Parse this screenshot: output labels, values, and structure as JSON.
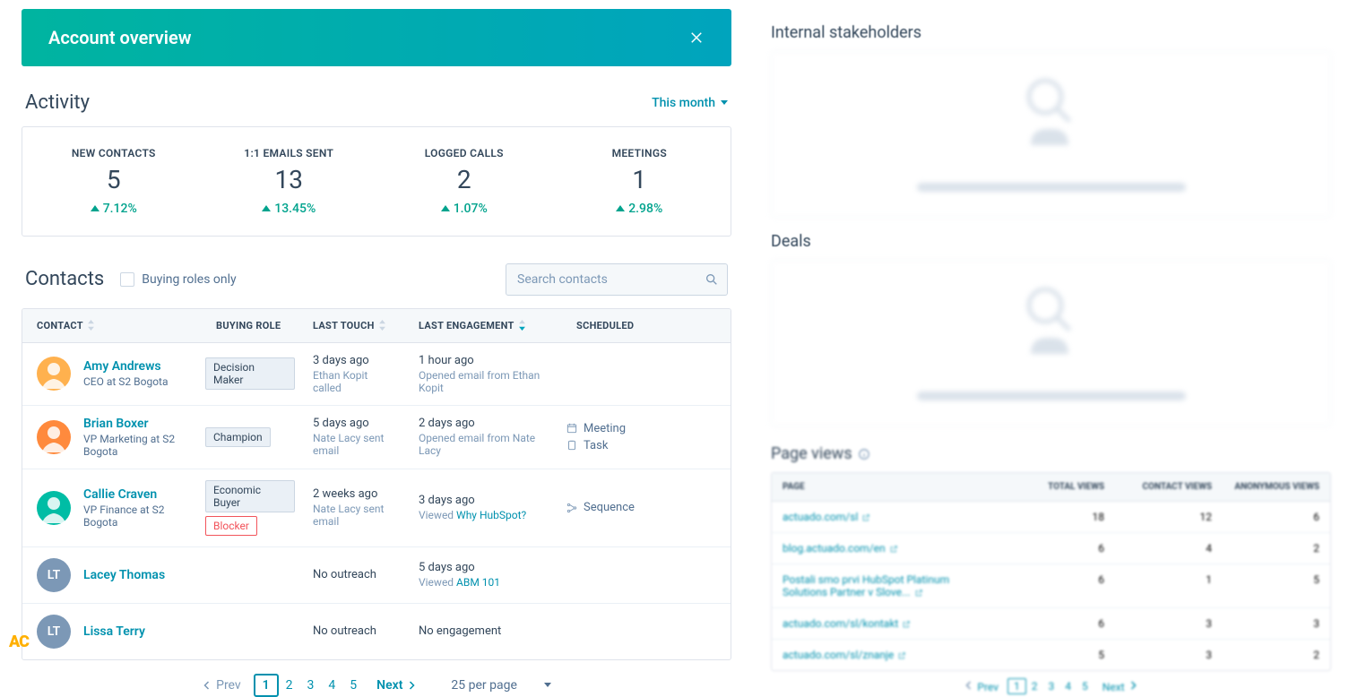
{
  "header": {
    "title": "Account overview"
  },
  "activity": {
    "heading": "Activity",
    "filter_label": "This month",
    "metrics": [
      {
        "label": "NEW CONTACTS",
        "value": "5",
        "delta": "7.12%"
      },
      {
        "label": "1:1 EMAILS SENT",
        "value": "13",
        "delta": "13.45%"
      },
      {
        "label": "LOGGED CALLS",
        "value": "2",
        "delta": "1.07%"
      },
      {
        "label": "MEETINGS",
        "value": "1",
        "delta": "2.98%"
      }
    ]
  },
  "contacts": {
    "heading": "Contacts",
    "buying_roles_label": "Buying roles only",
    "search_placeholder": "Search contacts",
    "columns": {
      "contact": "CONTACT",
      "buying_role": "BUYING ROLE",
      "last_touch": "LAST TOUCH",
      "last_engagement": "LAST ENGAGEMENT",
      "scheduled": "SCHEDULED"
    },
    "rows": [
      {
        "name": "Amy Andrews",
        "title": "CEO at S2 Bogota",
        "avatar_bg": "#ffb14e",
        "initials": "",
        "roles": [
          "Decision Maker"
        ],
        "touch_main": "3 days ago",
        "touch_sub": "Ethan Kopit called",
        "eng_main": "1 hour ago",
        "eng_sub": "Opened email from Ethan Kopit",
        "eng_link": "",
        "sched": []
      },
      {
        "name": "Brian Boxer",
        "title": "VP Marketing at S2 Bogota",
        "avatar_bg": "#ff8a3d",
        "initials": "",
        "roles": [
          "Champion"
        ],
        "touch_main": "5 days ago",
        "touch_sub": "Nate Lacy sent email",
        "eng_main": "2 days ago",
        "eng_sub": "Opened email from Nate Lacy",
        "eng_link": "",
        "sched": [
          "Meeting",
          "Task"
        ]
      },
      {
        "name": "Callie Craven",
        "title": "VP Finance at S2 Bogota",
        "avatar_bg": "#00bda5",
        "initials": "",
        "roles": [
          "Economic Buyer",
          "Blocker"
        ],
        "touch_main": "2 weeks ago",
        "touch_sub": "Nate Lacy sent email",
        "eng_main": "3 days ago",
        "eng_sub": "Viewed ",
        "eng_link": "Why HubSpot?",
        "sched": [
          "Sequence"
        ]
      },
      {
        "name": "Lacey Thomas",
        "title": "",
        "avatar_bg": "#7c98b6",
        "initials": "LT",
        "roles": [],
        "touch_main": "No outreach",
        "touch_sub": "",
        "eng_main": "5 days ago",
        "eng_sub": "Viewed ",
        "eng_link": "ABM 101",
        "sched": []
      },
      {
        "name": "Lissa Terry",
        "title": "",
        "avatar_bg": "#7c98b6",
        "initials": "LT",
        "roles": [],
        "touch_main": "No outreach",
        "touch_sub": "",
        "eng_main": "No engagement",
        "eng_sub": "",
        "eng_link": "",
        "sched": []
      }
    ],
    "pager": {
      "prev": "Prev",
      "next": "Next",
      "pages": [
        "1",
        "2",
        "3",
        "4",
        "5"
      ],
      "active": "1",
      "per_page": "25 per page"
    }
  },
  "right": {
    "stakeholders_heading": "Internal stakeholders",
    "deals_heading": "Deals",
    "page_views_heading": "Page views",
    "pv_columns": {
      "page": "PAGE",
      "total": "TOTAL VIEWS",
      "contact": "CONTACT VIEWS",
      "anon": "ANONYMOUS VIEWS"
    },
    "pv_rows": [
      {
        "page": "actuado.com/sl",
        "total": "18",
        "contact": "12",
        "anon": "6"
      },
      {
        "page": "blog.actuado.com/en",
        "total": "6",
        "contact": "4",
        "anon": "2"
      },
      {
        "page": "Postali smo prvi HubSpot Platinum Solutions Partner v Slove...",
        "total": "6",
        "contact": "1",
        "anon": "5"
      },
      {
        "page": "actuado.com/sl/kontakt",
        "total": "6",
        "contact": "3",
        "anon": "3"
      },
      {
        "page": "actuado.com/sl/znanje",
        "total": "5",
        "contact": "3",
        "anon": "2"
      }
    ],
    "pv_pager": {
      "prev": "Prev",
      "next": "Next",
      "pages": [
        "1",
        "2",
        "3",
        "4",
        "5"
      ],
      "active": "1"
    }
  },
  "logo": "AC"
}
